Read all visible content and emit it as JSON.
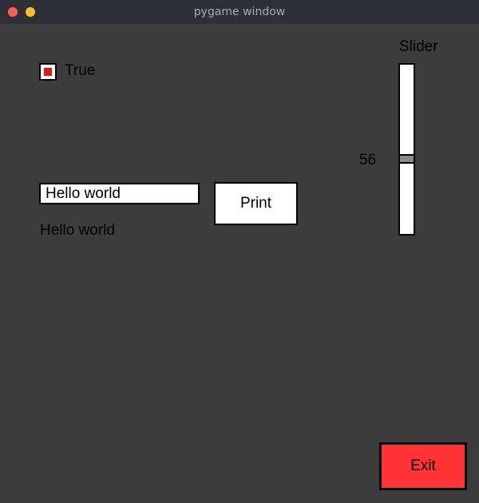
{
  "window": {
    "title": "pygame window"
  },
  "checkbox": {
    "checked": true,
    "label": "True",
    "mark_color": "#ee1111"
  },
  "text_input": {
    "value": "Hello world"
  },
  "print_button": {
    "label": "Print"
  },
  "output": {
    "text": "Hello world"
  },
  "slider": {
    "title": "Slider",
    "value": "56",
    "min": 0,
    "max": 100,
    "orientation": "vertical",
    "thumb_color": "#8a8a8a"
  },
  "exit_button": {
    "label": "Exit",
    "color": "#ff3333"
  },
  "colors": {
    "background": "#3c3c3c",
    "titlebar": "#2e3035"
  }
}
